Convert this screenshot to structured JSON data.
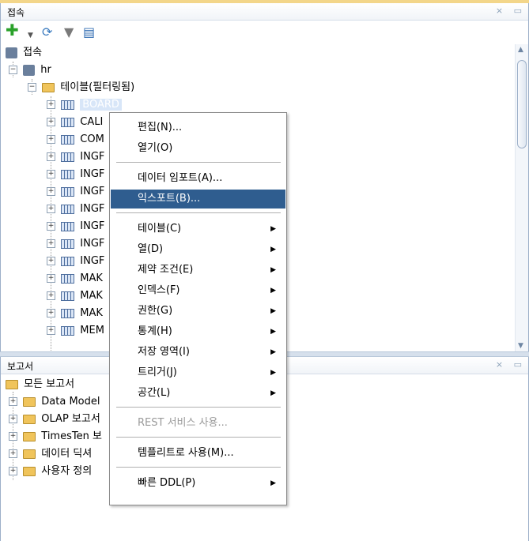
{
  "connections_panel": {
    "title": "접속",
    "controls": [
      "×",
      "▭"
    ],
    "tree": {
      "root": "접속",
      "connection": "hr",
      "tables_folder": "테이블(필터링됨)",
      "tables": [
        "BOARD",
        "CALI",
        "COM",
        "INGF",
        "INGF",
        "INGF",
        "INGF",
        "INGF",
        "INGF",
        "INGF",
        "MAK",
        "MAK",
        "MAK",
        "MEM"
      ]
    }
  },
  "reports_panel": {
    "title": "보고서",
    "controls": [
      "×",
      "▭"
    ],
    "root": "모든 보고서",
    "items": [
      "Data Model",
      "OLAP 보고서",
      "TimesTen 보",
      "데이터 딕셔",
      "사용자 정의"
    ]
  },
  "context_menu": {
    "items": [
      {
        "label": "편집(N)...",
        "submenu": false
      },
      {
        "label": "열기(O)",
        "submenu": false
      },
      {
        "label": "데이터 임포트(A)...",
        "submenu": false
      },
      {
        "label": "익스포트(B)...",
        "submenu": false,
        "highlighted": true
      },
      {
        "label": "테이블(C)",
        "submenu": true
      },
      {
        "label": "열(D)",
        "submenu": true
      },
      {
        "label": "제약 조건(E)",
        "submenu": true
      },
      {
        "label": "인덱스(F)",
        "submenu": true
      },
      {
        "label": "권한(G)",
        "submenu": true
      },
      {
        "label": "통계(H)",
        "submenu": true
      },
      {
        "label": "저장 영역(I)",
        "submenu": true
      },
      {
        "label": "트리거(J)",
        "submenu": true
      },
      {
        "label": "공간(L)",
        "submenu": true
      },
      {
        "label": "REST 서비스 사용...",
        "submenu": false,
        "disabled": true
      },
      {
        "label": "템플리트로 사용(M)...",
        "submenu": false
      },
      {
        "label": "빠른 DDL(P)",
        "submenu": true
      }
    ]
  },
  "colors": {
    "menu_highlight": "#2f5d8f",
    "title_accent": "#f3d68a"
  }
}
